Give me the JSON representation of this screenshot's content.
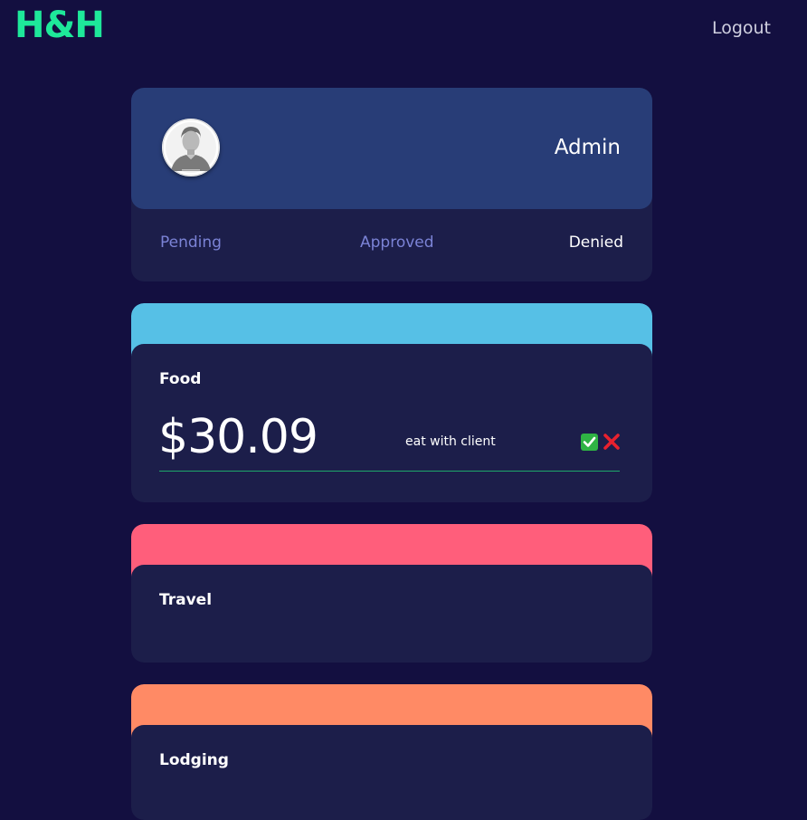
{
  "header": {
    "logo": "H&H",
    "logout_label": "Logout"
  },
  "profile": {
    "role": "Admin",
    "avatar": "user-avatar-placeholder"
  },
  "tabs": [
    {
      "label": "Pending",
      "active": false
    },
    {
      "label": "Approved",
      "active": false
    },
    {
      "label": "Denied",
      "active": true
    }
  ],
  "expenses": [
    {
      "category": "Food",
      "amount": "$30.09",
      "note": "eat with client",
      "accent": "#56c0e6",
      "actions": [
        "approve-icon",
        "deny-icon"
      ]
    },
    {
      "category": "Travel",
      "accent": "#ff5e7b"
    },
    {
      "category": "Lodging",
      "accent": "#ff8a65"
    }
  ],
  "colors": {
    "background": "#130f40",
    "logo": "#1ee89a",
    "card": "#1c1e4a",
    "profile_header": "#283d77",
    "tab_inactive": "#7b83d6",
    "underline": "#1ea86a"
  }
}
